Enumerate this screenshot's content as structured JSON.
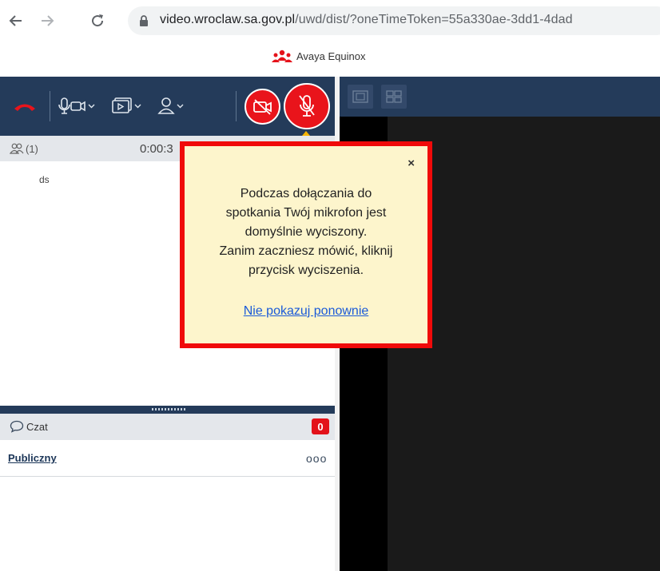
{
  "browser": {
    "url_domain": "video.wroclaw.sa.gov.pl",
    "url_path": "/uwd/dist/?oneTimeToken=55a330ae-3dd1-4dad"
  },
  "app": {
    "title": "Avaya Equinox",
    "logo_icon": "people-group-icon",
    "logo_color": "#e5121a"
  },
  "participants": {
    "count": "(1)",
    "timer": "0:00:3",
    "names": [
      "ds"
    ]
  },
  "chat": {
    "label": "Czat",
    "unread_count": "0",
    "public_label": "Publiczny",
    "more_label": "ooo"
  },
  "popup": {
    "close_label": "×",
    "message": "Podczas dołączania do\nspotkania Twój mikrofon jest\ndomyślnie wyciszony.\nZanim zaczniesz mówić, kliknij\nprzycisk wyciszenia.",
    "link_label": "Nie pokazuj ponownie"
  },
  "colors": {
    "toolbar_bg": "#243b5a",
    "accent_red": "#e9141b",
    "popup_bg": "#fdf5cc",
    "popup_border": "#f00a0a",
    "link": "#1a5ad8"
  }
}
